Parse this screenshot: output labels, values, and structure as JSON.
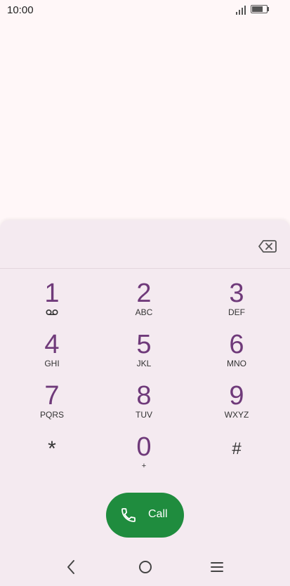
{
  "status_bar": {
    "time": "10:00"
  },
  "backspace": {
    "icon": "backspace-icon"
  },
  "keys": [
    {
      "digit": "1",
      "letters": "",
      "icon": "voicemail-icon"
    },
    {
      "digit": "2",
      "letters": "ABC"
    },
    {
      "digit": "3",
      "letters": "DEF"
    },
    {
      "digit": "4",
      "letters": "GHI"
    },
    {
      "digit": "5",
      "letters": "JKL"
    },
    {
      "digit": "6",
      "letters": "MNO"
    },
    {
      "digit": "7",
      "letters": "PQRS"
    },
    {
      "digit": "8",
      "letters": "TUV"
    },
    {
      "digit": "9",
      "letters": "WXYZ"
    },
    {
      "digit": "*",
      "letters": ""
    },
    {
      "digit": "0",
      "letters": "+"
    },
    {
      "digit": "#",
      "letters": ""
    }
  ],
  "call": {
    "label": "Call",
    "color": "#1f8c3e"
  },
  "nav": {
    "back_icon": "back-icon",
    "home_icon": "home-icon",
    "recents_icon": "recents-icon"
  },
  "colors": {
    "accent": "#6f3a7a",
    "panel": "#f4eaf0",
    "background": "#fff7f8"
  }
}
